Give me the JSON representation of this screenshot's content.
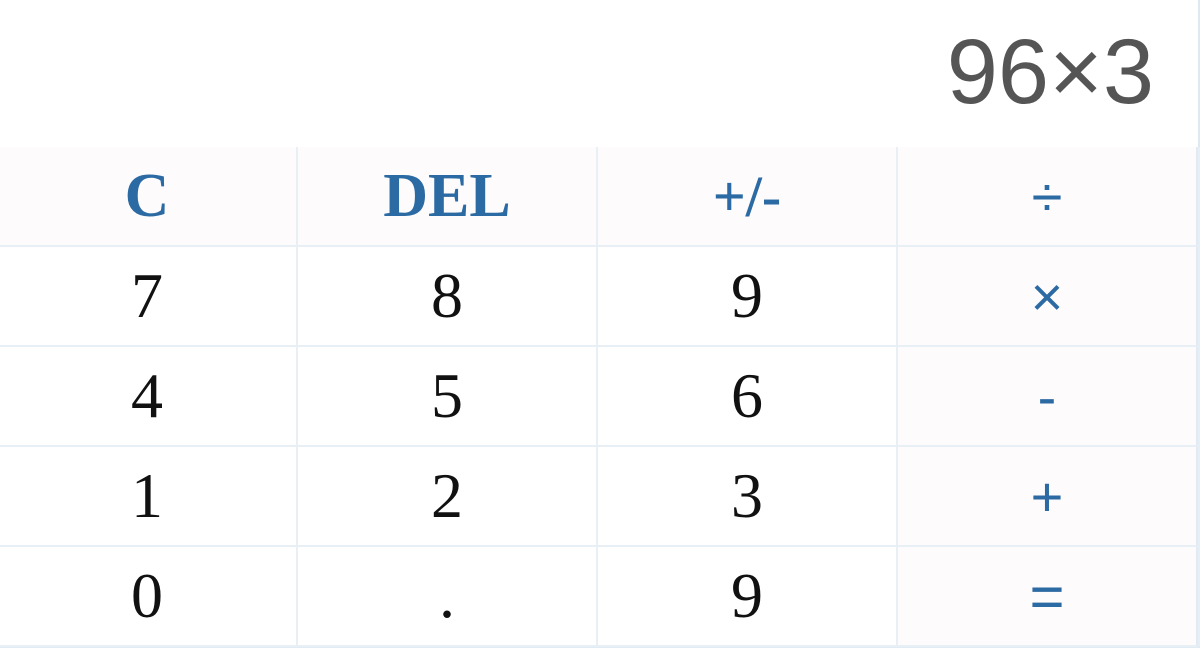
{
  "display": {
    "value": "96×3"
  },
  "keys": [
    {
      "label": "C"
    },
    {
      "label": "DEL"
    },
    {
      "label": "+/-"
    },
    {
      "label": "÷"
    },
    {
      "label": "7"
    },
    {
      "label": "8"
    },
    {
      "label": "9"
    },
    {
      "label": "×"
    },
    {
      "label": "4"
    },
    {
      "label": "5"
    },
    {
      "label": "6"
    },
    {
      "label": "-"
    },
    {
      "label": "1"
    },
    {
      "label": "2"
    },
    {
      "label": "3"
    },
    {
      "label": "+"
    },
    {
      "label": "0"
    },
    {
      "label": "."
    },
    {
      "label": "9"
    },
    {
      "label": "="
    }
  ]
}
